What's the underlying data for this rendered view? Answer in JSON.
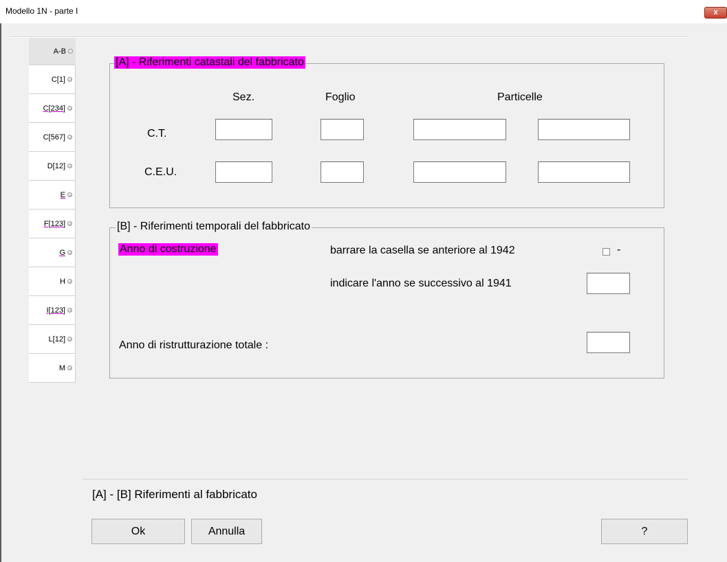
{
  "window": {
    "title": "Modello 1N  -  parte I",
    "close_glyph": "x"
  },
  "tabs": [
    {
      "label": "A-B",
      "active": true,
      "underline": false
    },
    {
      "label": "C[1]",
      "active": false,
      "underline": false
    },
    {
      "label": "C[234]",
      "active": false,
      "underline": true
    },
    {
      "label": "C[567]",
      "active": false,
      "underline": false
    },
    {
      "label": "D[12]",
      "active": false,
      "underline": false
    },
    {
      "label": "E",
      "active": false,
      "underline": true
    },
    {
      "label": "F[123]",
      "active": false,
      "underline": true
    },
    {
      "label": "G",
      "active": false,
      "underline": true
    },
    {
      "label": "H",
      "active": false,
      "underline": false
    },
    {
      "label": "I[123]",
      "active": false,
      "underline": true
    },
    {
      "label": "L[12]",
      "active": false,
      "underline": false
    },
    {
      "label": "M",
      "active": false,
      "underline": false
    }
  ],
  "sectionA": {
    "title": "[A] - Riferimenti catastali del fabbricato",
    "col_sez": "Sez.",
    "col_foglio": "Foglio",
    "col_particelle": "Particelle",
    "row_ct": "C.T.",
    "row_ceu": "C.E.U.",
    "values": {
      "ct_sez": "",
      "ct_foglio": "",
      "ct_part1": "",
      "ct_part2": "",
      "ceu_sez": "",
      "ceu_foglio": "",
      "ceu_part1": "",
      "ceu_part2": ""
    }
  },
  "sectionB": {
    "title": "[B] - Riferimenti temporali del fabbricato",
    "anno_label": "Anno di costruzione",
    "checkbox_label": "barrare la casella se anteriore al 1942",
    "checkbox_suffix": "-",
    "anno_label2": "indicare l'anno se successivo al 1941",
    "ristrutt_label": "Anno di ristrutturazione  totale :",
    "values": {
      "anno_successivo": "",
      "anno_ristrutturazione": "",
      "anteriore_1942": false
    }
  },
  "footer": {
    "status": "[A] - [B] Riferimenti al fabbricato",
    "ok": "Ok",
    "annulla": "Annulla",
    "help": "?"
  }
}
